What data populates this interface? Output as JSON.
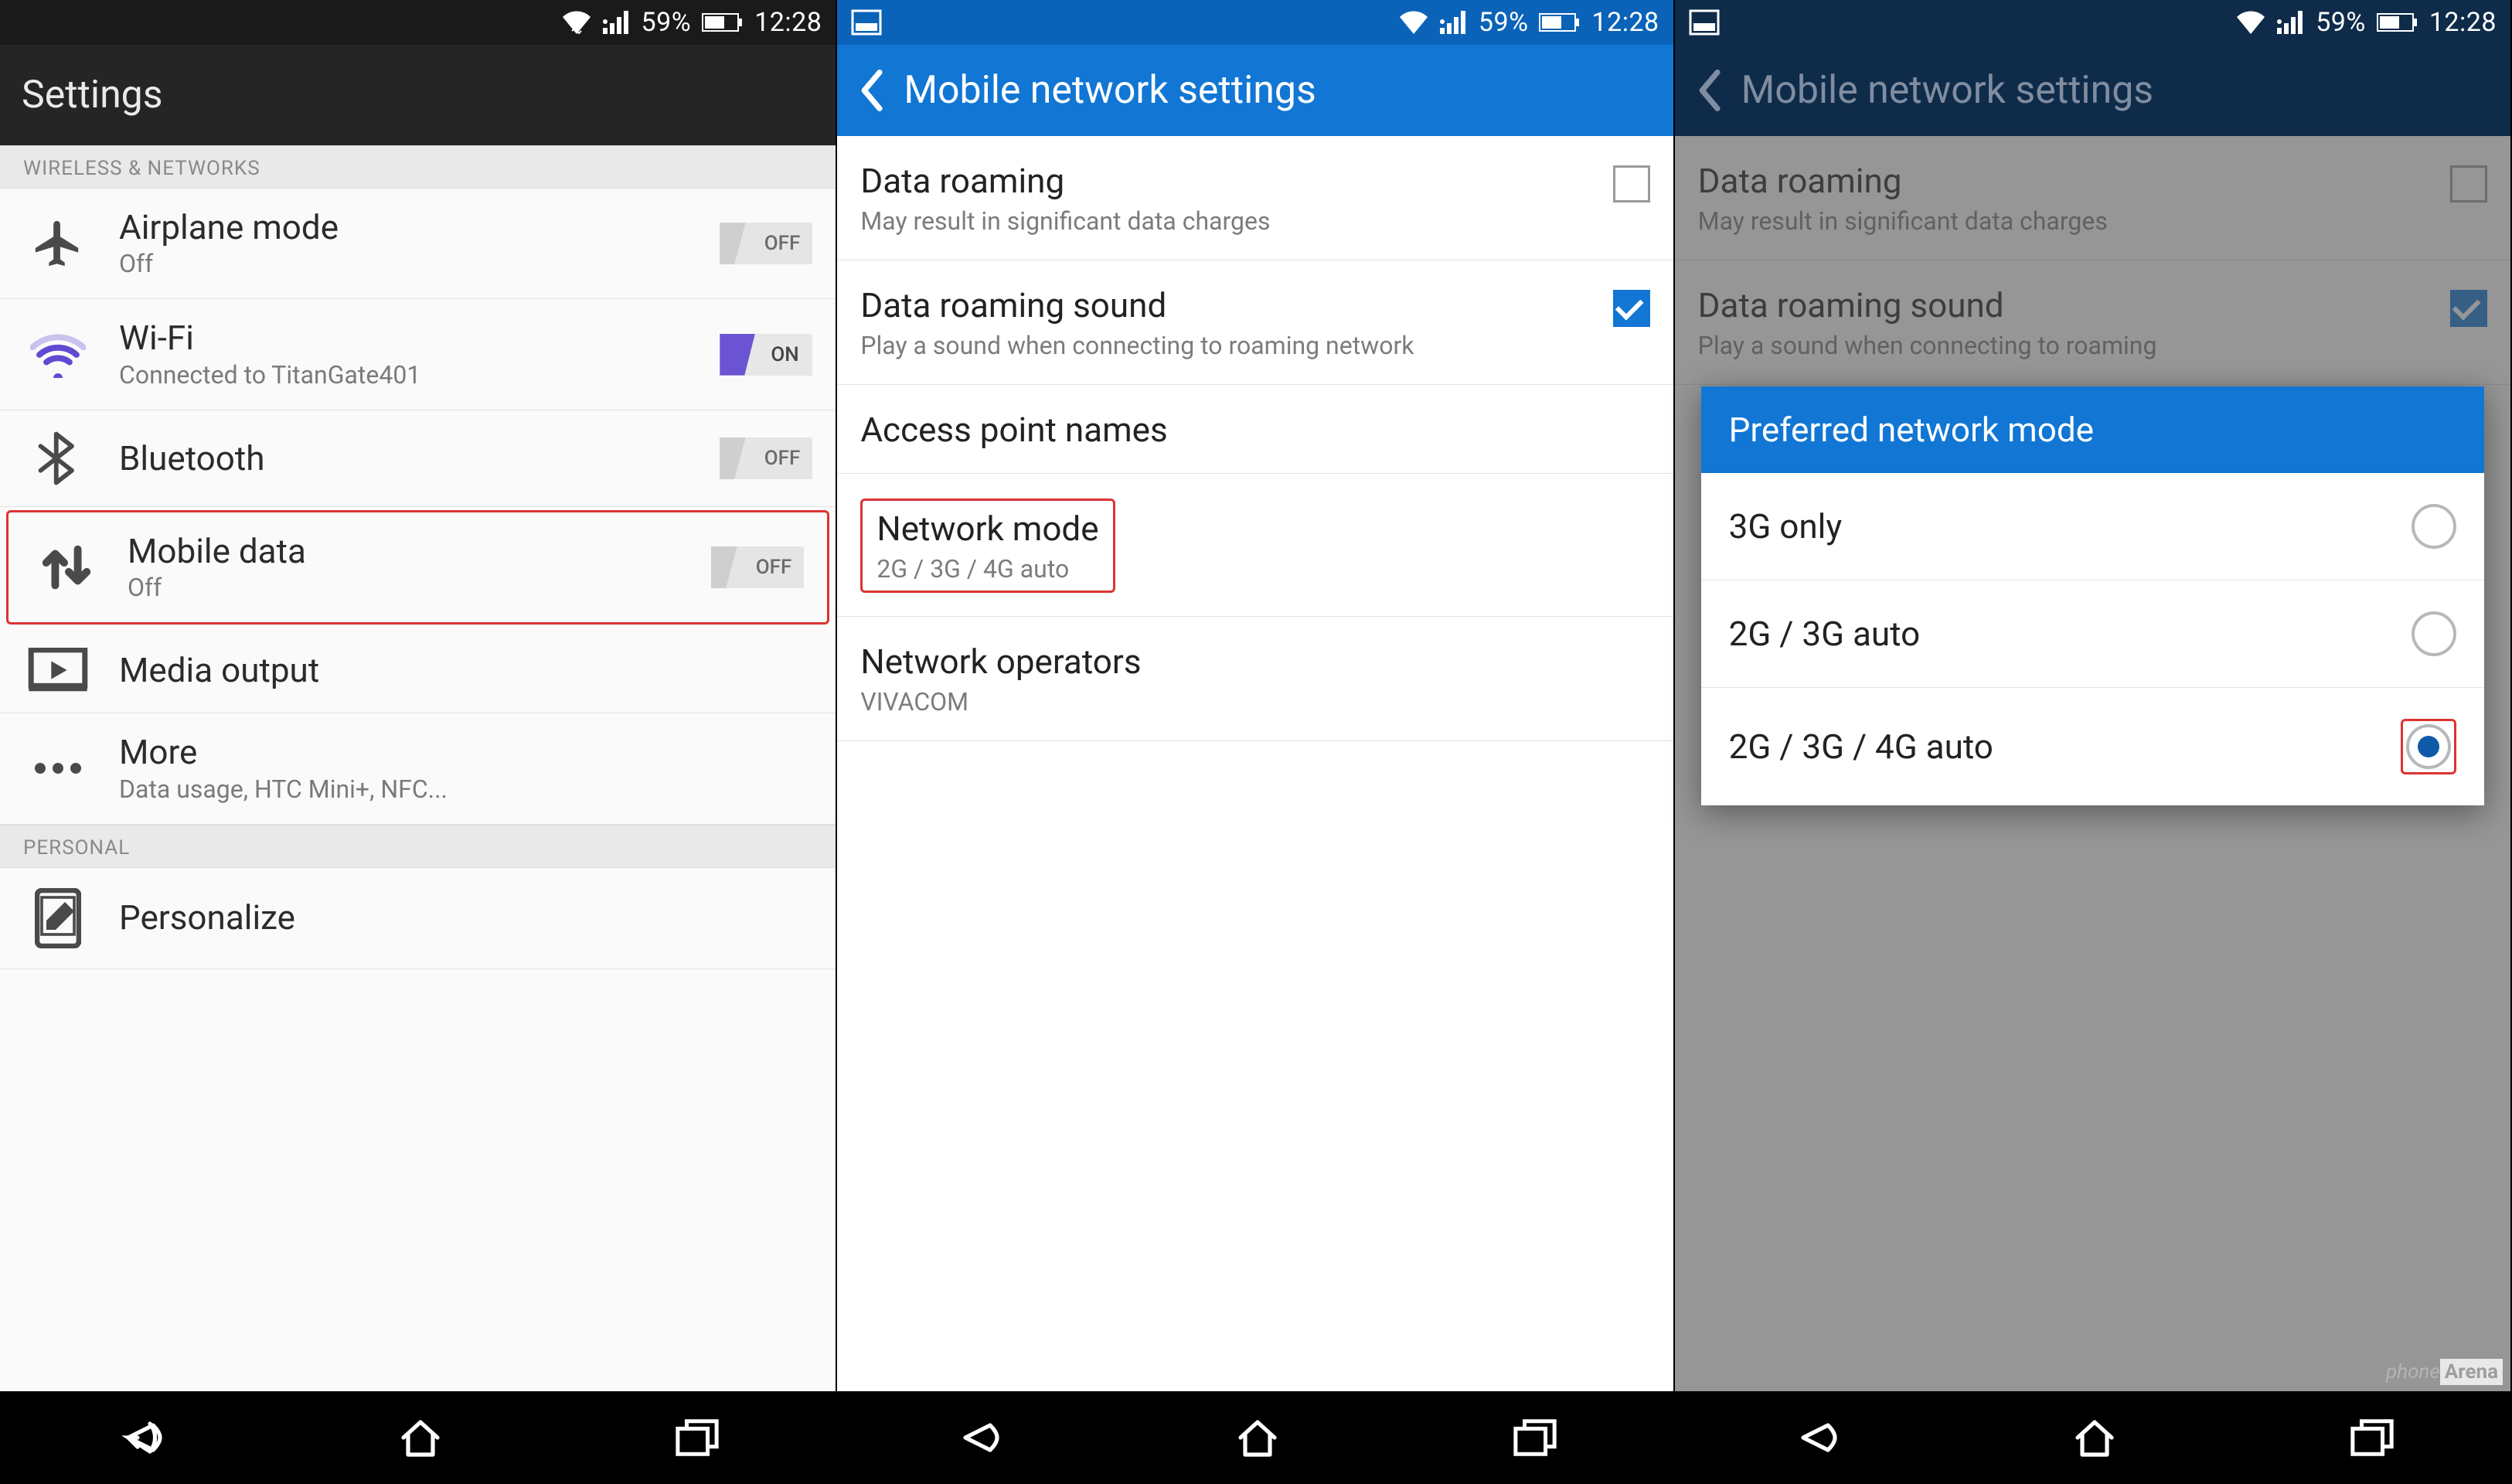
{
  "status": {
    "battery_pct": "59%",
    "time": "12:28"
  },
  "screen1": {
    "title": "Settings",
    "categories": {
      "wireless": "WIRELESS & NETWORKS",
      "personal": "PERSONAL"
    },
    "items": {
      "airplane": {
        "title": "Airplane mode",
        "sub": "Off",
        "toggle": "OFF"
      },
      "wifi": {
        "title": "Wi-Fi",
        "sub": "Connected to TitanGate401",
        "toggle": "ON"
      },
      "bluetooth": {
        "title": "Bluetooth",
        "toggle": "OFF"
      },
      "mobiledata": {
        "title": "Mobile data",
        "sub": "Off",
        "toggle": "OFF"
      },
      "media": {
        "title": "Media output"
      },
      "more": {
        "title": "More",
        "sub": "Data usage, HTC Mini+, NFC..."
      },
      "personalize": {
        "title": "Personalize"
      }
    }
  },
  "screen2": {
    "title": "Mobile network settings",
    "items": {
      "roaming": {
        "title": "Data roaming",
        "sub": "May result in significant data charges",
        "checked": false
      },
      "roaming_sound": {
        "title": "Data roaming sound",
        "sub": "Play a sound when connecting to roaming network",
        "checked": true
      },
      "apn": {
        "title": "Access point names"
      },
      "netmode": {
        "title": "Network mode",
        "sub": "2G / 3G / 4G auto"
      },
      "operators": {
        "title": "Network operators",
        "sub": "VIVACOM"
      }
    }
  },
  "screen3": {
    "title": "Mobile network settings",
    "dialog_title": "Preferred network mode",
    "options": [
      {
        "label": "3G only",
        "selected": false
      },
      {
        "label": "2G / 3G auto",
        "selected": false
      },
      {
        "label": "2G / 3G / 4G auto",
        "selected": true
      }
    ],
    "bg": {
      "roaming": {
        "title": "Data roaming",
        "sub": "May result in significant data charges"
      },
      "roaming_sound": {
        "title": "Data roaming sound",
        "sub": "Play a sound when connecting to roaming"
      }
    }
  },
  "watermark": {
    "a": "phone",
    "b": "Arena"
  }
}
